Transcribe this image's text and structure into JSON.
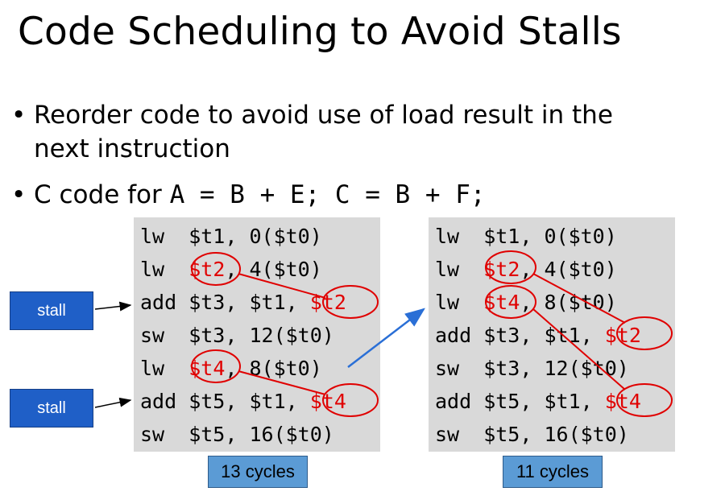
{
  "title": "Code Scheduling to Avoid Stalls",
  "bullets": [
    {
      "line1": "Reorder code to avoid use of load result in the",
      "line2": "next instruction"
    },
    {
      "prefix": "C code for ",
      "code": "A = B + E; C = B + F;"
    }
  ],
  "left_code": {
    "lines": [
      {
        "op": "lw ",
        "args": [
          {
            "t": " $t1, 0($t0)",
            "r": false
          }
        ]
      },
      {
        "op": "lw ",
        "args": [
          {
            "t": " ",
            "r": false
          },
          {
            "t": "$t2",
            "r": true
          },
          {
            "t": ", 4($t0)",
            "r": false
          }
        ]
      },
      {
        "op": "add",
        "args": [
          {
            "t": " $t3, $t1, ",
            "r": false
          },
          {
            "t": "$t2",
            "r": true
          }
        ]
      },
      {
        "op": "sw ",
        "args": [
          {
            "t": " $t3, 12($t0)",
            "r": false
          }
        ]
      },
      {
        "op": "lw ",
        "args": [
          {
            "t": " ",
            "r": false
          },
          {
            "t": "$t4",
            "r": true
          },
          {
            "t": ", 8($t0)",
            "r": false
          }
        ]
      },
      {
        "op": "add",
        "args": [
          {
            "t": " $t5, $t1, ",
            "r": false
          },
          {
            "t": "$t4",
            "r": true
          }
        ]
      },
      {
        "op": "sw ",
        "args": [
          {
            "t": " $t5, 16($t0)",
            "r": false
          }
        ]
      }
    ],
    "cycles_label": "13 cycles"
  },
  "right_code": {
    "lines": [
      {
        "op": "lw ",
        "args": [
          {
            "t": " $t1, 0($t0)",
            "r": false
          }
        ]
      },
      {
        "op": "lw ",
        "args": [
          {
            "t": " ",
            "r": false
          },
          {
            "t": "$t2",
            "r": true
          },
          {
            "t": ", 4($t0)",
            "r": false
          }
        ]
      },
      {
        "op": "lw ",
        "args": [
          {
            "t": " ",
            "r": false
          },
          {
            "t": "$t4",
            "r": true
          },
          {
            "t": ", 8($t0)",
            "r": false
          }
        ]
      },
      {
        "op": "add",
        "args": [
          {
            "t": " $t3, $t1, ",
            "r": false
          },
          {
            "t": "$t2",
            "r": true
          }
        ]
      },
      {
        "op": "sw ",
        "args": [
          {
            "t": " $t3, 12($t0)",
            "r": false
          }
        ]
      },
      {
        "op": "add",
        "args": [
          {
            "t": " $t5, $t1, ",
            "r": false
          },
          {
            "t": "$t4",
            "r": true
          }
        ]
      },
      {
        "op": "sw ",
        "args": [
          {
            "t": " $t5, 16($t0)",
            "r": false
          }
        ]
      }
    ],
    "cycles_label": "11 cycles"
  },
  "stall_labels": [
    "stall",
    "stall"
  ],
  "colors": {
    "highlight": "#e00000",
    "stall_box": "#1f5fc7",
    "cycles_box": "#5b9bd5",
    "code_bg": "#d9d9d9",
    "move_arrow": "#2a6fd6"
  }
}
